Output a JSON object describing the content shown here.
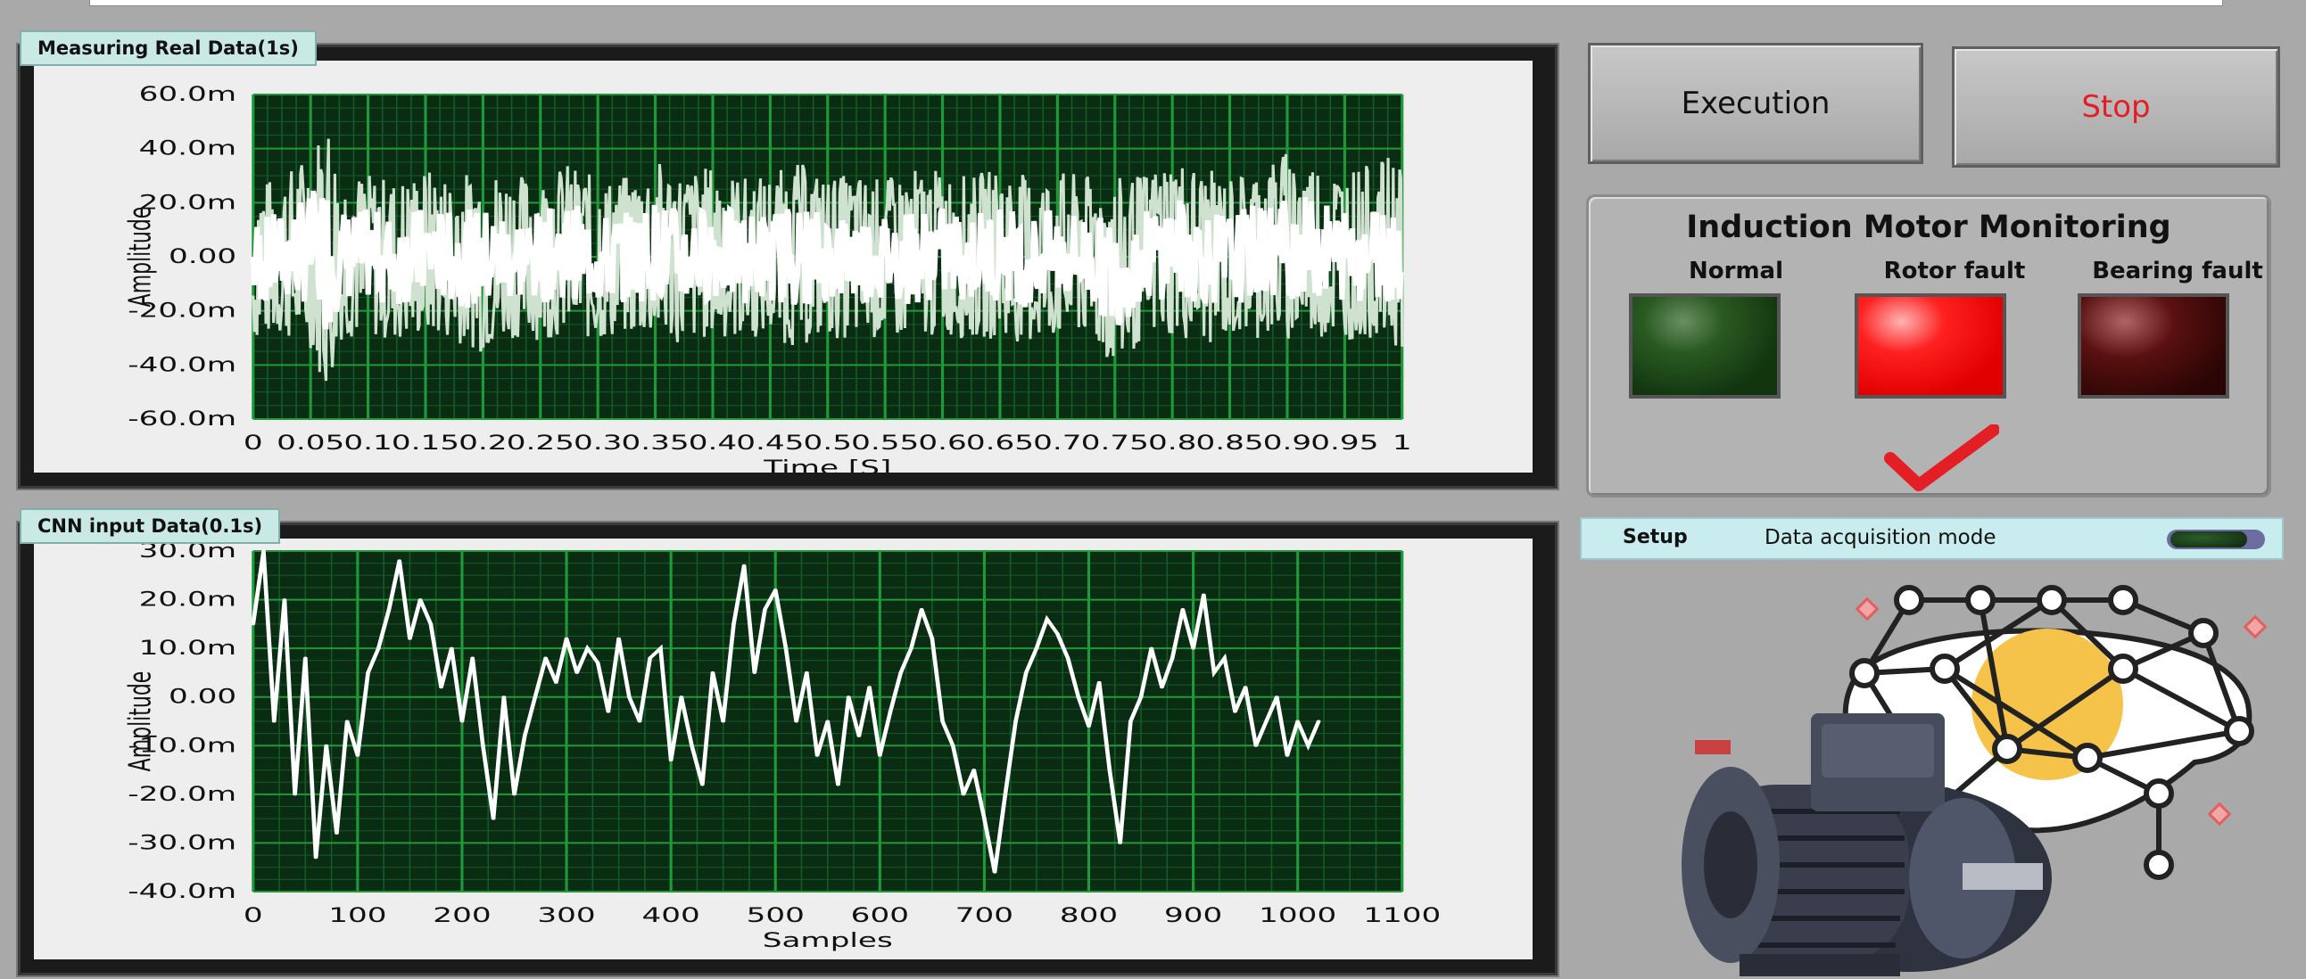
{
  "colors": {
    "plot_bg": "#0a2c12",
    "grid": "#1f9a3a",
    "trace": "#ffffff",
    "stop_text": "#e31e24",
    "led_normal": "#1e4a18",
    "led_rotor": "#ff1a1a",
    "led_bearing": "#4a0a0a",
    "check": "#e31e24"
  },
  "panels": {
    "real": {
      "label": "Measuring Real Data(1s)"
    },
    "cnn": {
      "label": "CNN input Data(0.1s)"
    }
  },
  "buttons": {
    "execution": "Execution",
    "stop": "Stop"
  },
  "monitor": {
    "title": "Induction Motor Monitoring",
    "indicators": [
      {
        "label": "Normal",
        "state": "off"
      },
      {
        "label": "Rotor fault",
        "state": "on"
      },
      {
        "label": "Bearing fault",
        "state": "off"
      }
    ],
    "selected_icon": "checkmark-icon"
  },
  "setup": {
    "label": "Setup",
    "mode_label": "Data acquisition mode",
    "toggle_state": "off"
  },
  "illustration": {
    "icons": [
      "induction-motor-icon",
      "neural-network-icon"
    ]
  },
  "chart_data": [
    {
      "type": "line",
      "xlabel": "Time [S]",
      "ylabel": "Amplitude",
      "xlim": [
        0,
        1
      ],
      "ylim": [
        -0.06,
        0.06
      ],
      "x_ticks": [
        0,
        0.05,
        0.1,
        0.15,
        0.2,
        0.25,
        0.3,
        0.35,
        0.4,
        0.45,
        0.5,
        0.55,
        0.6,
        0.65,
        0.7,
        0.75,
        0.8,
        0.85,
        0.9,
        0.95,
        1
      ],
      "x_tick_labels": [
        "0",
        "0.05",
        "0.1",
        "0.15",
        "0.2",
        "0.25",
        "0.3",
        "0.35",
        "0.4",
        "0.45",
        "0.5",
        "0.55",
        "0.6",
        "0.65",
        "0.7",
        "0.75",
        "0.8",
        "0.85",
        "0.9",
        "0.95",
        "1"
      ],
      "y_ticks": [
        0.06,
        0.04,
        0.02,
        0,
        -0.02,
        -0.04,
        -0.06
      ],
      "y_tick_labels": [
        "60.0m",
        "40.0m",
        "20.0m",
        "0.00",
        "-20.0m",
        "-40.0m",
        "-60.0m"
      ],
      "grid": true,
      "series": [
        {
          "x": [
            0,
            0.025,
            0.05,
            0.065,
            0.075,
            0.1,
            0.125,
            0.15,
            0.175,
            0.2,
            0.225,
            0.25,
            0.275,
            0.3,
            0.325,
            0.35,
            0.375,
            0.4,
            0.425,
            0.45,
            0.475,
            0.5,
            0.525,
            0.55,
            0.575,
            0.6,
            0.625,
            0.65,
            0.675,
            0.7,
            0.725,
            0.75,
            0.775,
            0.8,
            0.825,
            0.85,
            0.875,
            0.9,
            0.925,
            0.95,
            0.975,
            1
          ],
          "upper": [
            0.028,
            0.03,
            0.04,
            0.055,
            0.032,
            0.031,
            0.029,
            0.033,
            0.03,
            0.034,
            0.031,
            0.03,
            0.035,
            0.029,
            0.03,
            0.036,
            0.032,
            0.034,
            0.03,
            0.031,
            0.035,
            0.03,
            0.031,
            0.029,
            0.033,
            0.032,
            0.03,
            0.034,
            0.03,
            0.032,
            0.03,
            0.029,
            0.031,
            0.038,
            0.033,
            0.03,
            0.034,
            0.04,
            0.036,
            0.033,
            0.034,
            0.04
          ],
          "lower": [
            -0.032,
            -0.03,
            -0.034,
            -0.053,
            -0.031,
            -0.03,
            -0.032,
            -0.03,
            -0.031,
            -0.036,
            -0.03,
            -0.031,
            -0.029,
            -0.032,
            -0.03,
            -0.031,
            -0.033,
            -0.03,
            -0.031,
            -0.03,
            -0.034,
            -0.03,
            -0.031,
            -0.03,
            -0.032,
            -0.029,
            -0.031,
            -0.03,
            -0.033,
            -0.031,
            -0.03,
            -0.043,
            -0.031,
            -0.03,
            -0.033,
            -0.031,
            -0.03,
            -0.032,
            -0.03,
            -0.031,
            -0.03,
            -0.034
          ]
        }
      ]
    },
    {
      "type": "line",
      "xlabel": "Samples",
      "ylabel": "Amplitude",
      "xlim": [
        0,
        1100
      ],
      "ylim": [
        -0.04,
        0.03
      ],
      "x_ticks": [
        0,
        100,
        200,
        300,
        400,
        500,
        600,
        700,
        800,
        900,
        1000,
        1100
      ],
      "x_tick_labels": [
        "0",
        "100",
        "200",
        "300",
        "400",
        "500",
        "600",
        "700",
        "800",
        "900",
        "1000",
        "1100"
      ],
      "y_ticks": [
        0.03,
        0.02,
        0.01,
        0,
        -0.01,
        -0.02,
        -0.03,
        -0.04
      ],
      "y_tick_labels": [
        "30.0m",
        "20.0m",
        "10.0m",
        "0.00",
        "-10.0m",
        "-20.0m",
        "-30.0m",
        "-40.0m"
      ],
      "grid": true,
      "series": [
        {
          "x": [
            0,
            10,
            20,
            30,
            40,
            50,
            60,
            70,
            80,
            90,
            100,
            110,
            120,
            130,
            140,
            150,
            160,
            170,
            180,
            190,
            200,
            210,
            220,
            230,
            240,
            250,
            260,
            270,
            280,
            290,
            300,
            310,
            320,
            330,
            340,
            350,
            360,
            370,
            380,
            390,
            400,
            410,
            420,
            430,
            440,
            450,
            460,
            470,
            480,
            490,
            500,
            510,
            520,
            530,
            540,
            550,
            560,
            570,
            580,
            590,
            600,
            610,
            620,
            630,
            640,
            650,
            660,
            670,
            680,
            690,
            700,
            710,
            720,
            730,
            740,
            750,
            760,
            770,
            780,
            790,
            800,
            810,
            820,
            830,
            840,
            850,
            860,
            870,
            880,
            890,
            900,
            910,
            920,
            930,
            940,
            950,
            960,
            970,
            980,
            990,
            1000,
            1010,
            1020
          ],
          "y": [
            0.015,
            0.03,
            -0.005,
            0.02,
            -0.02,
            0.008,
            -0.033,
            -0.01,
            -0.028,
            -0.005,
            -0.012,
            0.005,
            0.01,
            0.018,
            0.028,
            0.012,
            0.02,
            0.015,
            0.002,
            0.01,
            -0.005,
            0.008,
            -0.01,
            -0.025,
            0.0,
            -0.02,
            -0.008,
            0.0,
            0.008,
            0.003,
            0.012,
            0.005,
            0.01,
            0.007,
            -0.003,
            0.012,
            0.0,
            -0.005,
            0.008,
            0.01,
            -0.013,
            0.0,
            -0.01,
            -0.018,
            0.005,
            -0.005,
            0.015,
            0.027,
            0.005,
            0.018,
            0.022,
            0.01,
            -0.005,
            0.005,
            -0.012,
            -0.005,
            -0.018,
            0.0,
            -0.008,
            0.002,
            -0.012,
            -0.003,
            0.005,
            0.01,
            0.018,
            0.012,
            -0.005,
            -0.01,
            -0.02,
            -0.015,
            -0.025,
            -0.036,
            -0.02,
            -0.005,
            0.005,
            0.01,
            0.016,
            0.013,
            0.008,
            0.0,
            -0.006,
            0.003,
            -0.015,
            -0.03,
            -0.005,
            0.0,
            0.01,
            0.002,
            0.008,
            0.018,
            0.01,
            0.021,
            0.005,
            0.008,
            -0.003,
            0.002,
            -0.01,
            -0.005,
            0.0,
            -0.012,
            -0.005,
            -0.01,
            -0.005
          ]
        }
      ]
    }
  ]
}
